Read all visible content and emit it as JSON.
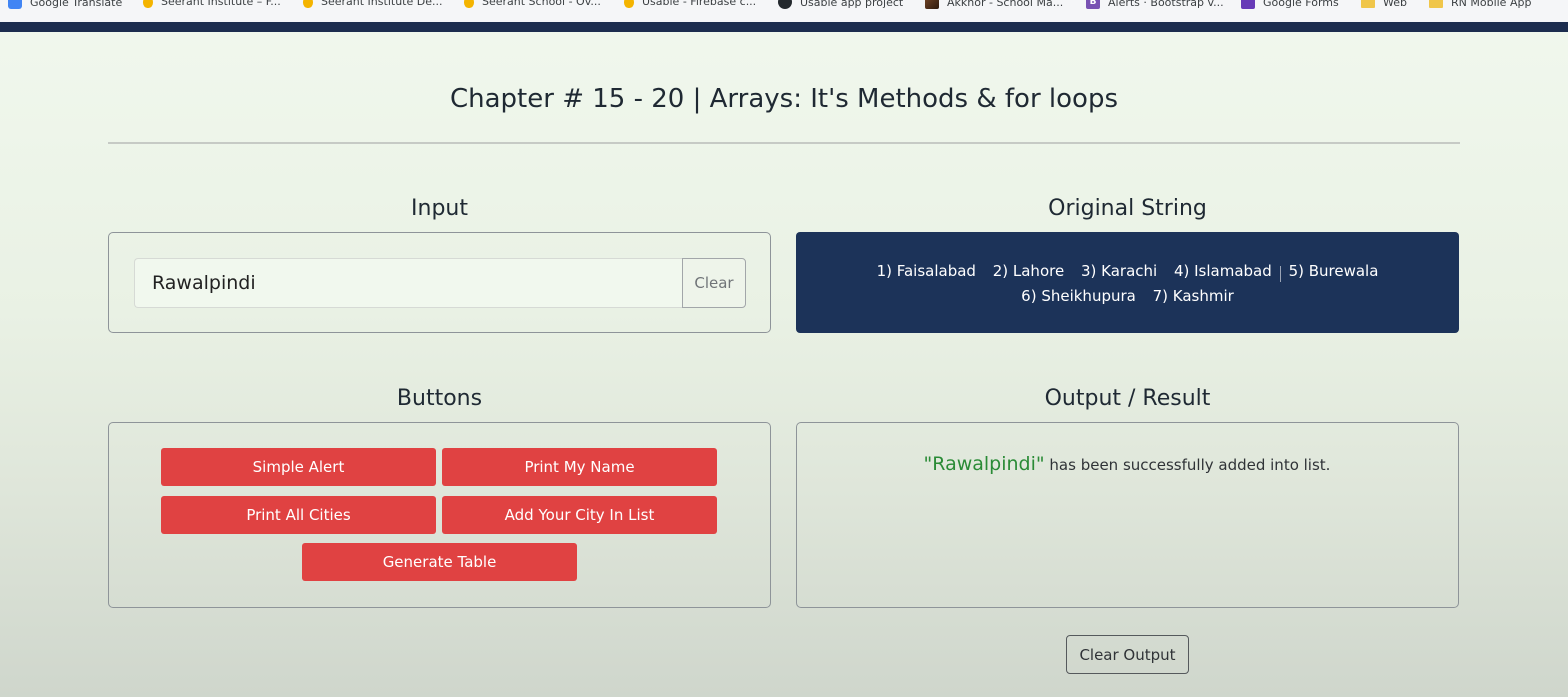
{
  "bookmarks": [
    {
      "label": "Google Translate",
      "icon": "google-translate-icon"
    },
    {
      "label": "Seerant Institute – F...",
      "icon": "firebase-icon"
    },
    {
      "label": "Seerant Institute De...",
      "icon": "firebase-icon"
    },
    {
      "label": "Seerant School - Ov...",
      "icon": "firebase-icon"
    },
    {
      "label": "Usable - Firebase c...",
      "icon": "firebase-icon"
    },
    {
      "label": "Usable app project",
      "icon": "github-icon"
    },
    {
      "label": "Akkhor - School Ma...",
      "icon": "site-icon"
    },
    {
      "label": "Alerts · Bootstrap v...",
      "icon": "bootstrap-icon"
    },
    {
      "label": "Google Forms",
      "icon": "google-forms-icon"
    },
    {
      "label": "Web",
      "icon": "folder-icon"
    },
    {
      "label": "RN Mobile App",
      "icon": "folder-icon"
    }
  ],
  "page": {
    "title": "Chapter # 15 - 20 | Arrays: It's Methods & for loops"
  },
  "input_section": {
    "title": "Input",
    "value": "Rawalpindi",
    "clear_label": "Clear"
  },
  "original_section": {
    "title": "Original String",
    "cities": [
      "1) Faisalabad",
      "2) Lahore",
      "3) Karachi",
      "4) Islamabad",
      "5) Burewala",
      "6) Sheikhupura",
      "7) Kashmir"
    ]
  },
  "buttons_section": {
    "title": "Buttons",
    "simple_alert": "Simple Alert",
    "print_name": "Print My Name",
    "print_cities": "Print All Cities",
    "add_city": "Add Your City In List",
    "generate_table": "Generate Table"
  },
  "output_section": {
    "title": "Output / Result",
    "city": "\"Rawalpindi\"",
    "message": " has been successfully added into list.",
    "clear_output_label": "Clear Output"
  },
  "colors": {
    "navbar": "#1c2d4f",
    "original_panel_bg": "#1c3359",
    "button_red": "#e04242",
    "success_green": "#2a8b36"
  }
}
